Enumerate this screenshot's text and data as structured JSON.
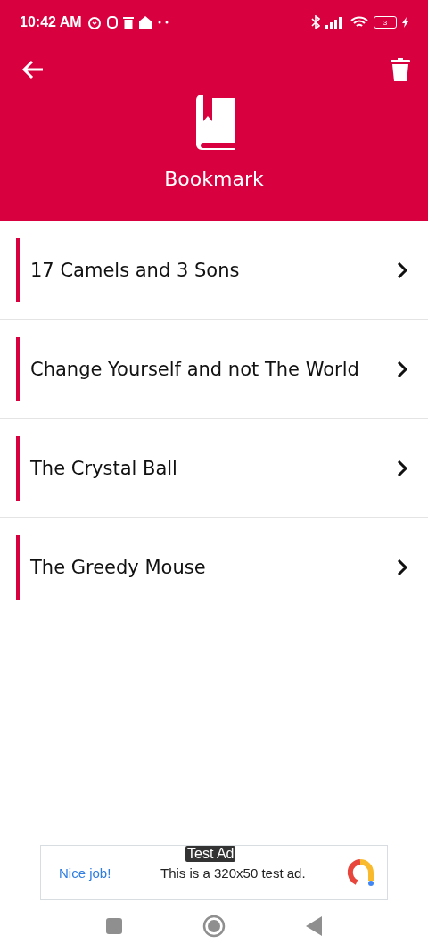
{
  "status_bar": {
    "time": "10:42 AM",
    "battery": "3"
  },
  "header": {
    "title": "Bookmark"
  },
  "bookmarks": [
    {
      "title": "17 Camels and 3 Sons"
    },
    {
      "title": "Change Yourself and not The World"
    },
    {
      "title": "The Crystal Ball"
    },
    {
      "title": "The Greedy Mouse"
    }
  ],
  "ad": {
    "badge": "Test Ad",
    "headline": "Nice job!",
    "text": "This is a 320x50 test ad."
  }
}
